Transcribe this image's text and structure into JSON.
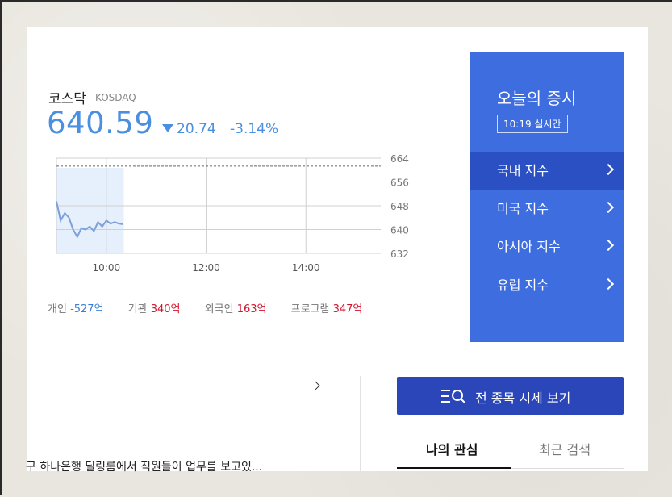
{
  "index": {
    "name": "코스닥",
    "name_en": "KOSDAQ",
    "value": "640.59",
    "change": "20.74",
    "change_pct": "-3.14%",
    "direction": "down",
    "color": "#4a8fe0"
  },
  "chart_data": {
    "type": "line",
    "x_ticks": [
      "10:00",
      "12:00",
      "14:00"
    ],
    "y_ticks": [
      632,
      640,
      648,
      656,
      664
    ],
    "ylim": [
      632,
      664
    ],
    "xlim": [
      "09:00",
      "15:30"
    ],
    "prev_close": 661.33,
    "x": [
      "09:00",
      "09:05",
      "09:10",
      "09:15",
      "09:20",
      "09:25",
      "09:30",
      "09:35",
      "09:40",
      "09:45",
      "09:50",
      "09:55",
      "10:00",
      "10:05",
      "10:10",
      "10:15",
      "10:20"
    ],
    "values": [
      649.5,
      643.0,
      645.5,
      644.0,
      640.0,
      637.5,
      640.5,
      640.0,
      641.0,
      639.5,
      642.5,
      641.0,
      643.0,
      642.0,
      642.5,
      642.0,
      641.8
    ],
    "grid": true,
    "line_color": "#7ea0d8",
    "area_color": "#e6f0fc"
  },
  "investors": [
    {
      "label": "개인",
      "value": "-527억",
      "sign": "neg"
    },
    {
      "label": "기관",
      "value": "340억",
      "sign": "pos"
    },
    {
      "label": "외국인",
      "value": "163억",
      "sign": "pos"
    },
    {
      "label": "프로그램",
      "value": "347억",
      "sign": "pos"
    }
  ],
  "market_box": {
    "title": "오늘의 증시",
    "time": "10:19 실시간",
    "bg_color": "#3d6ddf",
    "items": [
      {
        "label": "국내 지수",
        "active": true
      },
      {
        "label": "미국 지수",
        "active": false
      },
      {
        "label": "아시아 지수",
        "active": false
      },
      {
        "label": "유럽 지수",
        "active": false
      }
    ]
  },
  "all_stocks_button": {
    "label": "전 종목 시세 보기",
    "icon": "list-search-icon",
    "color": "#2a46b8"
  },
  "tabs": {
    "mine": "나의 관심",
    "recent": "최근 검색"
  },
  "news": {
    "headline": "구 하나은행 딜링룸에서 직원들이 업무를 보고있..."
  }
}
